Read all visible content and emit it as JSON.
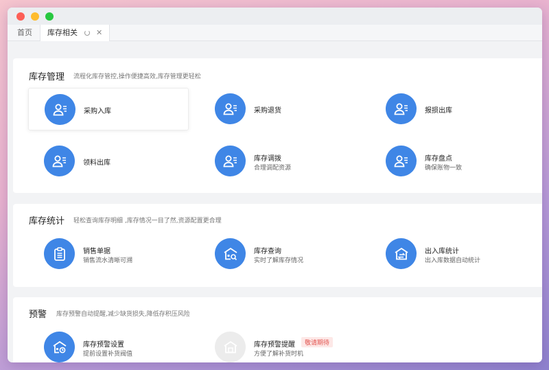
{
  "tabs": {
    "home": "首页",
    "active": "库存相关"
  },
  "sections": [
    {
      "title": "库存管理",
      "desc": "流程化库存管控,操作便捷高效,库存管理更轻松",
      "items": [
        {
          "name": "采购入库",
          "sub": "",
          "icon": "user-list-icon"
        },
        {
          "name": "采购退货",
          "sub": "",
          "icon": "user-list-icon"
        },
        {
          "name": "报损出库",
          "sub": "",
          "icon": "user-list-icon"
        },
        {
          "name": "领料出库",
          "sub": "",
          "icon": "user-list-icon"
        },
        {
          "name": "库存调拨",
          "sub": "合理调配资源",
          "icon": "user-list-icon"
        },
        {
          "name": "库存盘点",
          "sub": "确保账物一致",
          "icon": "user-list-icon"
        }
      ]
    },
    {
      "title": "库存统计",
      "desc": "轻松查询库存明细 ,库存情况一目了然,资源配置更合理",
      "items": [
        {
          "name": "销售单据",
          "sub": "销售流水清晰可溯",
          "icon": "clipboard-icon"
        },
        {
          "name": "库存查询",
          "sub": "实时了解库存情况",
          "icon": "warehouse-search-icon"
        },
        {
          "name": "出入库统计",
          "sub": "出入库数据自动统计",
          "icon": "warehouse-transfer-icon"
        }
      ]
    },
    {
      "title": "预警",
      "desc": "库存预警自动提醒,减少缺货损失,降低存积压风险",
      "items": [
        {
          "name": "库存预警设置",
          "sub": "提前设置补货阀值",
          "icon": "warehouse-clock-icon"
        },
        {
          "name": "库存预警提醒",
          "sub": "方便了解补货时机",
          "icon": "warehouse-icon",
          "badge": "敬请期待"
        }
      ]
    }
  ],
  "colors": {
    "accent": "#3f86e6",
    "disabled": "#ececec",
    "badge_text": "#e2544f",
    "badge_bg": "#fde8e7"
  }
}
